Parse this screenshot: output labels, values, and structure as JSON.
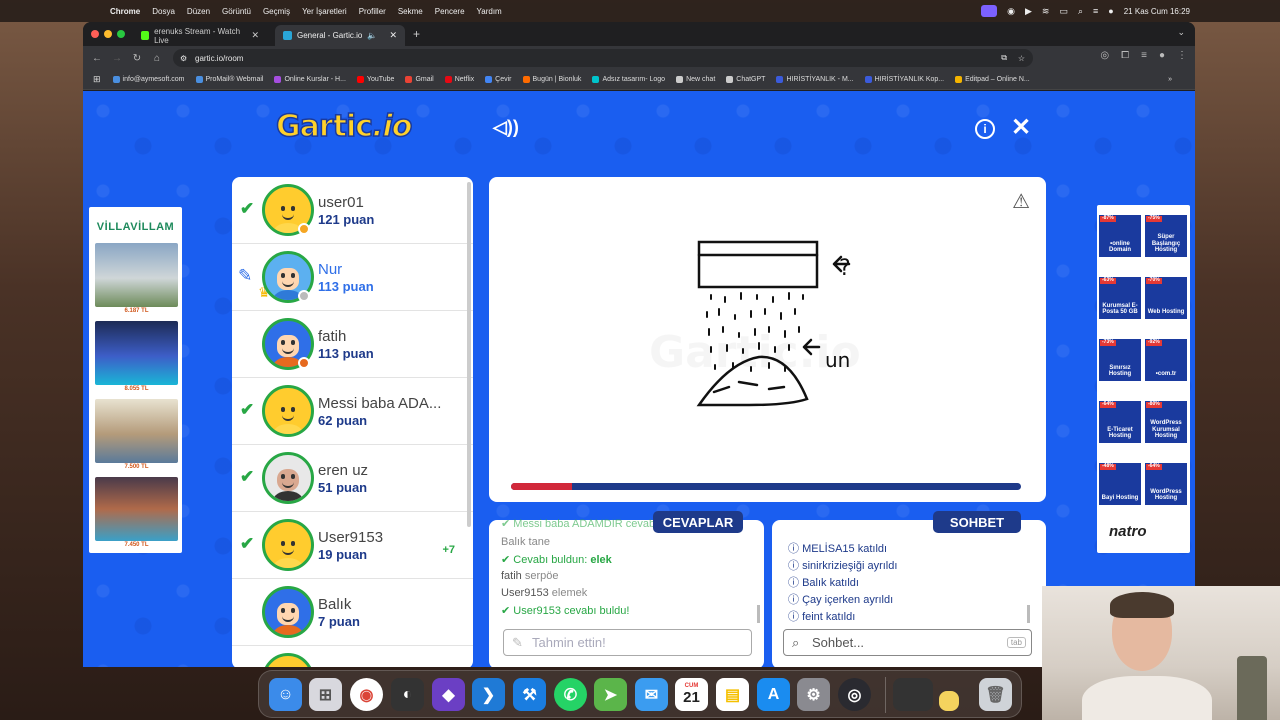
{
  "menubar": {
    "app": "Chrome",
    "items": [
      "Dosya",
      "Düzen",
      "Görüntü",
      "Geçmiş",
      "Yer İşaretleri",
      "Profiller",
      "Sekme",
      "Pencere",
      "Yardım"
    ],
    "clock": "21 Kas Cum  16:29"
  },
  "tabs": [
    {
      "title": "erenuks Stream - Watch Live",
      "close": "✕"
    },
    {
      "title": "General - Gartic.io",
      "close": "✕"
    }
  ],
  "toolbar": {
    "url": "gartic.io/room"
  },
  "bookmarks": [
    "info@aymesoft.com",
    "ProMail® Webmail",
    "Online Kurslar - H...",
    "YouTube",
    "Gmail",
    "Netflix",
    "Çevir",
    "Bugün | Bionluk",
    "Adsız tasarım- Logo",
    "New chat",
    "ChatGPT",
    "HIRİSTİYANLIK - M...",
    "HIRİSTİYANLIK Kop...",
    "Editpad – Online N..."
  ],
  "game": {
    "logo_main": "Gartic",
    "logo_suffix": ".io",
    "players": [
      {
        "name": "user01",
        "score": "121 puan",
        "status": "guessed",
        "badge": "#f5a623"
      },
      {
        "name": "Nur",
        "score": "113 puan",
        "status": "drawing",
        "badge": "#bbbbbb"
      },
      {
        "name": "fatih",
        "score": "113 puan",
        "status": "none",
        "badge": "#e66a1f"
      },
      {
        "name": "Messi baba ADA...",
        "score": "62 puan",
        "status": "guessed",
        "badge": ""
      },
      {
        "name": "eren uz",
        "score": "51 puan",
        "status": "guessed",
        "badge": ""
      },
      {
        "name": "User9153",
        "score": "19 puan",
        "status": "guessed",
        "badge": "",
        "plus": "+7"
      },
      {
        "name": "Balık",
        "score": "7 puan",
        "status": "none",
        "badge": ""
      }
    ],
    "drawing_labels": {
      "q": "?",
      "un": "un"
    },
    "timer_progress": 0.12,
    "answers_tab": "CEVAPLAR",
    "chat_tab": "SOHBET",
    "answers": [
      {
        "icon": "✔",
        "text": "Messi baba ADAMDIR cevabı buldu!",
        "style": "green"
      },
      {
        "user": "Balık",
        "text": "tane"
      },
      {
        "icon": "✔",
        "text": "Cevabı buldun: ",
        "bold": "elek",
        "style": "green"
      },
      {
        "user": "fatih",
        "text": "serpöe"
      },
      {
        "user": "User9153",
        "text": "elemek"
      },
      {
        "icon": "✔",
        "text": "User9153",
        "text2": " cevabı buldu!",
        "style": "green"
      }
    ],
    "answer_placeholder": "Tahmin ettin!",
    "chat": [
      {
        "name": "MELİSA15",
        "action": "katıldı"
      },
      {
        "name": "sinirkrizieşiği",
        "action": "ayrıldı"
      },
      {
        "name": "Balık",
        "action": "katıldı"
      },
      {
        "name": "Çay içerken",
        "action": "ayrıldı"
      },
      {
        "name": "feint",
        "action": "katıldı"
      }
    ],
    "chat_placeholder": "Sohbet...",
    "chat_key": "tab"
  },
  "ads": {
    "villa_brand": "VİLLAVİLLAM",
    "villa_prices": [
      "6.187 TL",
      "8.055 TL",
      "7.500 TL",
      "7.450 TL"
    ],
    "hosting_tiles": [
      {
        "label": "•online\nDomain",
        "disc": "-87%"
      },
      {
        "label": "Süper Başlangıç Hosting",
        "disc": "-75%"
      },
      {
        "label": "Kurumsal E-Posta 50 GB",
        "disc": "-63%"
      },
      {
        "label": "Web Hosting",
        "disc": "-70%"
      },
      {
        "label": "Sınırsız Hosting",
        "disc": "-73%"
      },
      {
        "label": "•com.tr",
        "disc": "-92%"
      },
      {
        "label": "E-Ticaret Hosting",
        "disc": "-64%"
      },
      {
        "label": "WordPress Kurumsal Hosting",
        "disc": "-80%"
      },
      {
        "label": "Bayi Hosting",
        "disc": "-48%"
      },
      {
        "label": "WordPress Hosting",
        "disc": "-64%"
      }
    ],
    "hosting_brand": "natro"
  },
  "dock": {
    "calendar_month": "CUM",
    "calendar_day": "21"
  }
}
